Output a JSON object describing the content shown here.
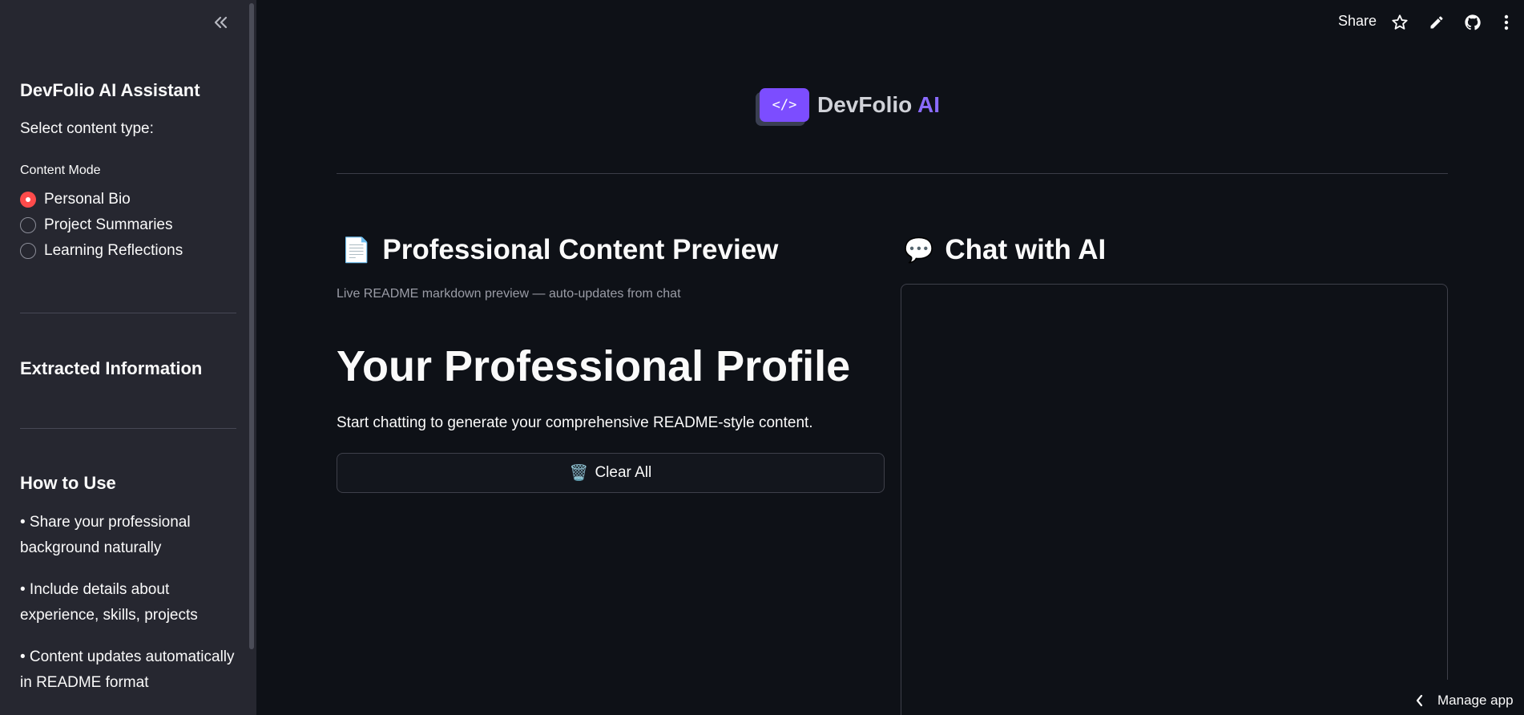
{
  "sidebar": {
    "title": "DevFolio AI Assistant",
    "select_prompt": "Select content type:",
    "radio_label": "Content Mode",
    "options": [
      {
        "label": "Personal Bio",
        "selected": true
      },
      {
        "label": "Project Summaries",
        "selected": false
      },
      {
        "label": "Learning Reflections",
        "selected": false
      }
    ],
    "extracted_heading": "Extracted Information",
    "how_heading": "How to Use",
    "tips": [
      "• Share your professional background naturally",
      "• Include details about experience, skills, projects",
      "• Content updates automatically in README format"
    ]
  },
  "toolbar": {
    "share_label": "Share",
    "icons": [
      "star-icon",
      "edit-icon",
      "github-icon",
      "more-vertical-icon"
    ]
  },
  "logo": {
    "mark": "</>",
    "name": "DevFolio",
    "suffix": "AI"
  },
  "preview": {
    "emoji": "📄",
    "heading": "Professional Content Preview",
    "caption": "Live README markdown preview — auto-updates from chat",
    "title": "Your Professional Profile",
    "body": "Start chatting to generate your comprehensive README-style content.",
    "clear_emoji": "🗑️",
    "clear_label": "Clear All"
  },
  "chat": {
    "emoji": "💬",
    "heading": "Chat with AI"
  },
  "footer": {
    "manage_label": "Manage app"
  },
  "colors": {
    "background": "#0e1117",
    "sidebar": "#262730",
    "accent_radio": "#ff4b4b",
    "logo_purple": "#7c4dff"
  }
}
